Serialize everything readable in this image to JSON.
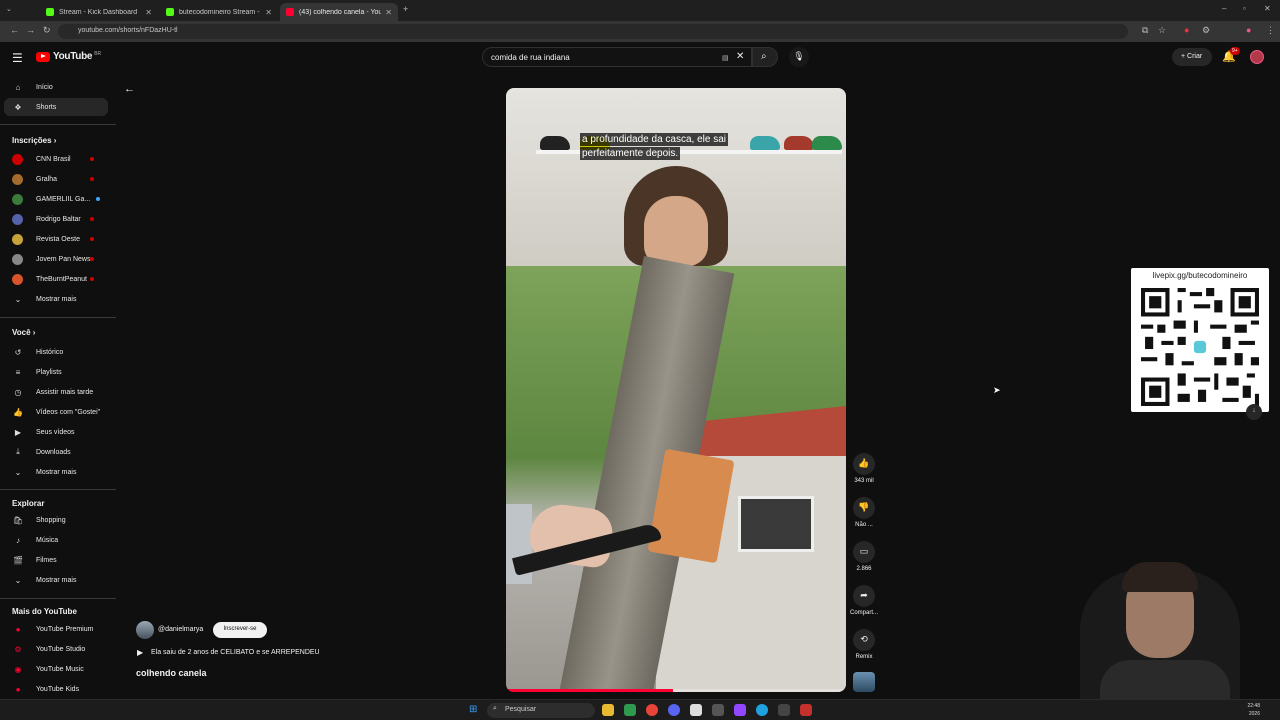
{
  "browser": {
    "tabs": [
      {
        "label": "Stream - Kick Dashboard",
        "favicon_color": "#53fc18",
        "active": false
      },
      {
        "label": "butecodomineiro Stream - Wa",
        "favicon_color": "#53fc18",
        "active": false
      },
      {
        "label": "(43) colhendo canela - You",
        "favicon_color": "#ff0033",
        "active": true
      }
    ],
    "url": "youtube.com/shorts/nFDazHU-tl"
  },
  "header": {
    "logo_text": "YouTube",
    "logo_cc": "BR",
    "search_value": "comida de rua indiana",
    "create_label": "Criar",
    "notifications": "9+"
  },
  "sidebar": {
    "main": [
      {
        "label": "Início",
        "icon": "home-icon"
      },
      {
        "label": "Shorts",
        "icon": "shorts-icon",
        "active": true
      }
    ],
    "subscriptions_title": "Inscrições",
    "subscriptions": [
      {
        "label": "CNN Brasil",
        "color": "#cc0000",
        "live": true
      },
      {
        "label": "Gralha",
        "color": "#a36b2c",
        "live": true
      },
      {
        "label": "GAMERLIIL Ga...",
        "color": "#3a7a3a",
        "live": false,
        "dot": true
      },
      {
        "label": "Rodrigo Baltar",
        "color": "#5561a8",
        "live": true
      },
      {
        "label": "Revista Oeste",
        "color": "#c7a23a",
        "live": true
      },
      {
        "label": "Jovem Pan News",
        "color": "#888888",
        "live": true
      },
      {
        "label": "TheBurntPeanut",
        "color": "#d9542b",
        "live": true
      }
    ],
    "show_more": "Mostrar mais",
    "you_title": "Você",
    "you": [
      {
        "label": "Histórico",
        "icon": "history-icon"
      },
      {
        "label": "Playlists",
        "icon": "playlists-icon"
      },
      {
        "label": "Assistir mais tarde",
        "icon": "watch-later-icon"
      },
      {
        "label": "Vídeos com \"Gostei\"",
        "icon": "like-icon"
      },
      {
        "label": "Seus vídeos",
        "icon": "your-videos-icon"
      },
      {
        "label": "Downloads",
        "icon": "download-icon"
      },
      {
        "label": "Mostrar mais",
        "icon": "chevron-down-icon"
      }
    ],
    "explore_title": "Explorar",
    "explore": [
      {
        "label": "Shopping",
        "icon": "shopping-icon"
      },
      {
        "label": "Música",
        "icon": "music-icon"
      },
      {
        "label": "Filmes",
        "icon": "movies-icon"
      },
      {
        "label": "Mostrar mais",
        "icon": "chevron-down-icon"
      }
    ],
    "more_title": "Mais do YouTube",
    "more": [
      {
        "label": "YouTube Premium"
      },
      {
        "label": "YouTube Studio"
      },
      {
        "label": "YouTube Music"
      },
      {
        "label": "YouTube Kids"
      }
    ]
  },
  "video": {
    "caption_line1": "a profundidade da casca, ele sai",
    "caption_line2": "perfeitamente depois.",
    "progress": 0.49,
    "channel": "@danielmarya",
    "subscribe": "Inscrever-se",
    "playlist_text": "Ela saiu de 2 anos de CELIBATO e se ARREPENDEU",
    "title": "colhendo canela"
  },
  "actions": [
    {
      "label": "343 mil",
      "icon": "like-icon"
    },
    {
      "label": "Não ...",
      "icon": "dislike-icon"
    },
    {
      "label": "2.866",
      "icon": "comment-icon"
    },
    {
      "label": "Compart...",
      "icon": "share-icon"
    },
    {
      "label": "Remix",
      "icon": "remix-icon"
    }
  ],
  "overlay": {
    "qr_url": "livepix.gg/butecodomineiro"
  },
  "taskbar": {
    "search_placeholder": "Pesquisar",
    "time": "22:48",
    "date": "2026"
  }
}
